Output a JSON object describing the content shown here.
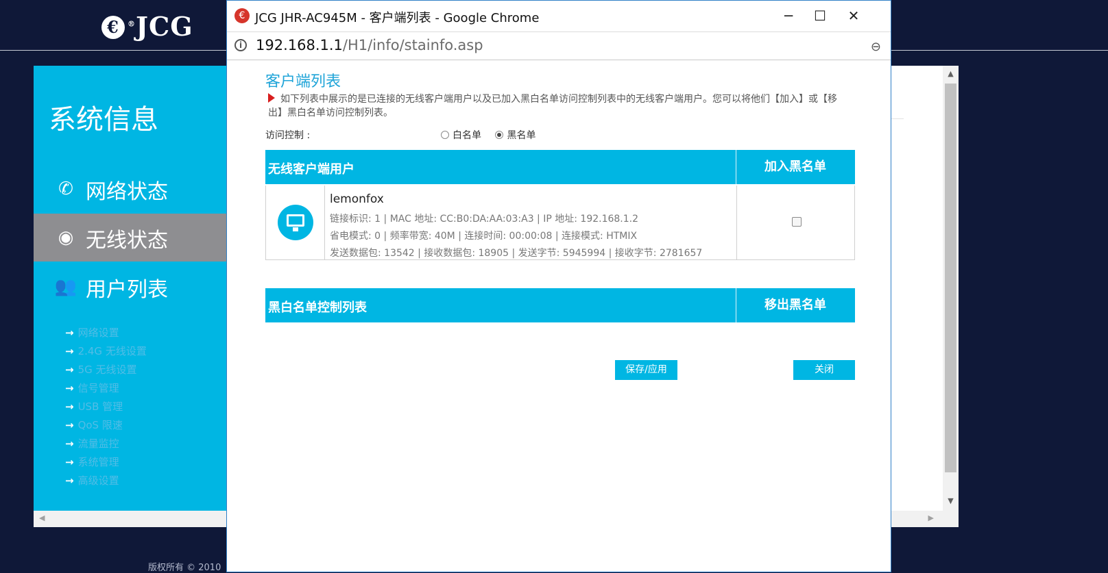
{
  "background": {
    "logo_text": "JCG",
    "sidebar_title": "系统信息",
    "menu": [
      {
        "label": "网络状态",
        "icon": "phone-icon"
      },
      {
        "label": "无线状态",
        "icon": "wifi-icon"
      },
      {
        "label": "用户列表",
        "icon": "users-icon"
      }
    ],
    "submenu": [
      "网络设置",
      "2.4G 无线设置",
      "5G 无线设置",
      "信号管理",
      "USB 管理",
      "QoS 限速",
      "流量监控",
      "系统管理",
      "高级设置"
    ],
    "copyright": "版权所有 © 2010"
  },
  "popup": {
    "window_title": "JCG JHR-AC945M - 客户端列表 - Google Chrome",
    "url_host": "192.168.1.1",
    "url_path": "/H1/info/stainfo.asp",
    "page_title": "客户端列表",
    "description": "如下列表中展示的是已连接的无线客户端用户以及已加入黑白名单访问控制列表中的无线客户端用户。您可以将他们【加入】或【移出】黑白名单访问控制列表。",
    "access_control_label": "访问控制 :",
    "radio_whitelist": "白名单",
    "radio_blacklist": "黑名单",
    "access_control_selected": "黑名单",
    "clients_table": {
      "col_user": "无线客户端用户",
      "col_action": "加入黑名单",
      "rows": [
        {
          "name": "lemonfox",
          "line1": "链接标识: 1   |  MAC 地址: CC:B0:DA:AA:03:A3   |  IP 地址: 192.168.1.2",
          "line2": "省电模式: 0   |  频率带宽: 40M   |  连接时间: 00:00:08   |  连接模式: HTMIX",
          "line3": "发送数据包: 13542   |  接收数据包: 18905   |  发送字节: 5945994   |  接收字节: 2781657",
          "checked": false
        }
      ]
    },
    "acl_table": {
      "col_list": "黑白名单控制列表",
      "col_action": "移出黑名单"
    },
    "save_button": "保存/应用",
    "close_button": "关闭"
  }
}
